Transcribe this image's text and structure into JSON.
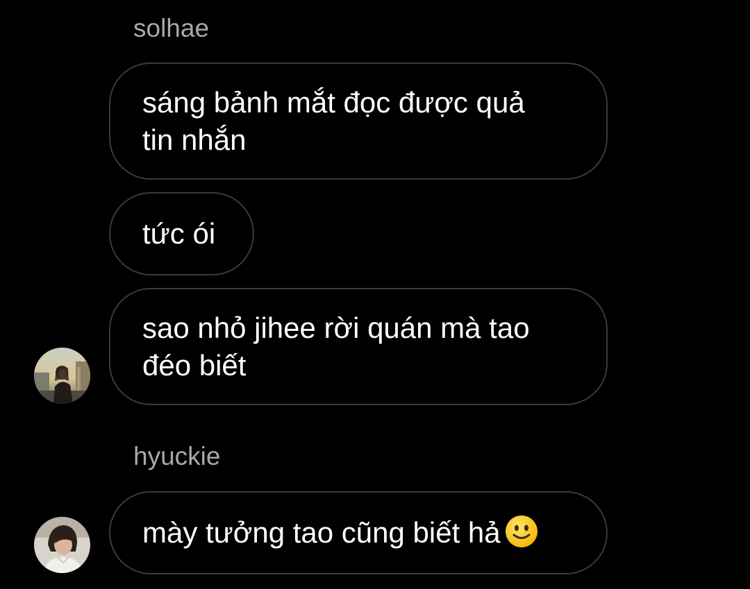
{
  "colors": {
    "background": "#000000",
    "bubble_border": "#3a3a3a",
    "sender_name": "#a8a8a8",
    "text": "#ffffff"
  },
  "thread": {
    "group1": {
      "sender": "solhae",
      "messages": [
        "sáng bảnh mắt đọc được quả\ntin nhắn",
        "tức ói",
        "sao nhỏ jihee rời quán mà tao\nđéo biết"
      ],
      "avatar_icon": "profile-photo-solhae"
    },
    "group2": {
      "sender": "hyuckie",
      "messages": [
        "mày tưởng tao cũng biết hả"
      ],
      "emoji": "slightly-smiling-face-emoji",
      "avatar_icon": "profile-photo-hyuckie"
    }
  }
}
